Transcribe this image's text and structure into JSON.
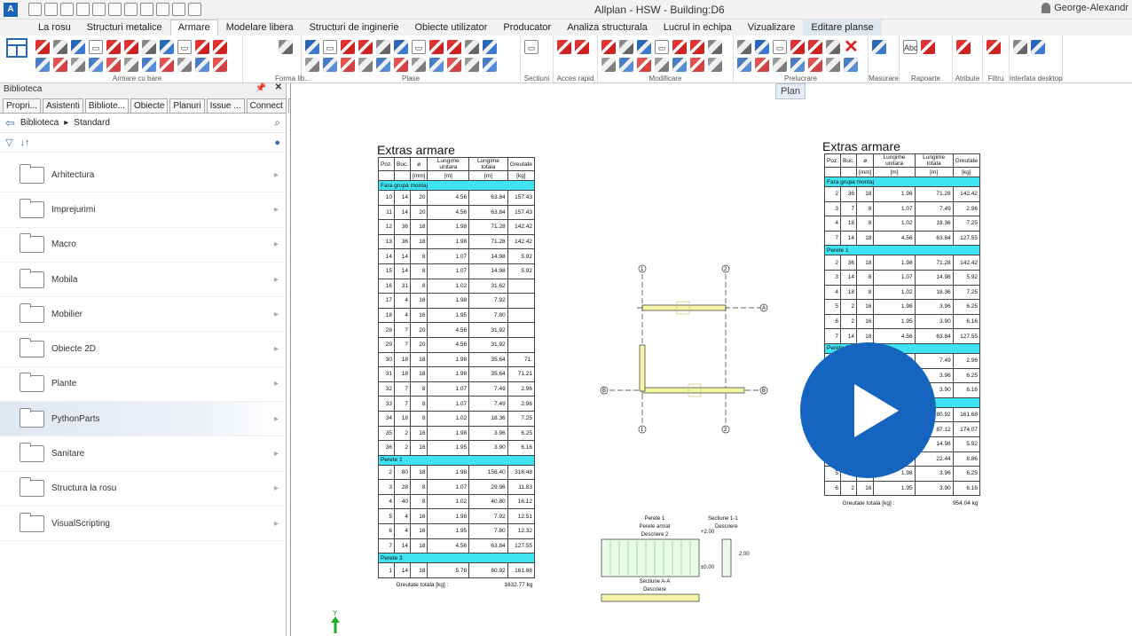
{
  "window": {
    "title": "Allplan - HSW - Building:D6",
    "user": "George-Alexandr"
  },
  "menu_tabs": [
    "La rosu",
    "Structuri metalice",
    "Armare",
    "Modelare libera",
    "Structuri de inginerie",
    "Obiecte utilizator",
    "Producator",
    "Analiza structurala",
    "Lucrul in echipa",
    "Vizualizare",
    "Editare planse"
  ],
  "ribbon_groups": [
    "Armare cu bare",
    "Forma lib...",
    "Plase",
    "Sectiuni",
    "Acces rapid",
    "Modificare",
    "Prelucrare",
    "Masurare",
    "Rapoarte",
    "Atribute",
    "Filtru",
    "Interfata desktop"
  ],
  "panel": {
    "title": "Biblioteca",
    "tabs": [
      "Propri...",
      "Asistenti",
      "Bibliote...",
      "Obiecte",
      "Planuri",
      "Issue ...",
      "Connect",
      "Layer"
    ],
    "breadcrumb": [
      "Biblioteca",
      "Standard"
    ],
    "folders": [
      "Arhitectura",
      "Imprejurimi",
      "Macro",
      "Mobila",
      "Mobilier",
      "Obiecte 2D",
      "Plante",
      "PythonParts",
      "Sanitare",
      "Structura la rosu",
      "VisualScripting"
    ],
    "selected": "PythonParts"
  },
  "view_label": "Plan",
  "left_table": {
    "title": "Extras armare",
    "headers": [
      "Poz.",
      "Buc.",
      "ø",
      "Lungime unitara",
      "Lungime totala",
      "Greutate"
    ],
    "units": [
      "",
      "",
      "[mm]",
      "[m]",
      "[m]",
      "[kg]"
    ],
    "groups": [
      {
        "name": "Fara grupa montaj",
        "rows": [
          [
            "10",
            "14",
            "20",
            "4.56",
            "63.84",
            "157.43"
          ],
          [
            "11",
            "14",
            "20",
            "4.56",
            "63.84",
            "157.43"
          ],
          [
            "12",
            "36",
            "18",
            "1.98",
            "71.28",
            "142.42"
          ],
          [
            "13",
            "36",
            "18",
            "1.98",
            "71.28",
            "142.42"
          ],
          [
            "14",
            "14",
            "8",
            "1.07",
            "14.98",
            "5.92"
          ],
          [
            "15",
            "14",
            "8",
            "1.07",
            "14.98",
            "5.92"
          ],
          [
            "16",
            "31",
            "8",
            "1.02",
            "31.62",
            ""
          ],
          [
            "17",
            "4",
            "16",
            "1.98",
            "7.92",
            ""
          ],
          [
            "18",
            "4",
            "16",
            "1.95",
            "7.80",
            ""
          ],
          [
            "28",
            "7",
            "20",
            "4.56",
            "31.92",
            ""
          ],
          [
            "29",
            "7",
            "20",
            "4.56",
            "31.92",
            ""
          ],
          [
            "30",
            "18",
            "18",
            "1.98",
            "35.64",
            "71."
          ],
          [
            "31",
            "18",
            "18",
            "1.98",
            "35.64",
            "71.21"
          ],
          [
            "32",
            "7",
            "8",
            "1.07",
            "7.49",
            "2.96"
          ],
          [
            "33",
            "7",
            "8",
            "1.07",
            "7.49",
            "2.96"
          ],
          [
            "34",
            "18",
            "8",
            "1.02",
            "18.36",
            "7.25"
          ],
          [
            "35",
            "2",
            "16",
            "1.98",
            "3.96",
            "6.25"
          ],
          [
            "36",
            "2",
            "16",
            "1.95",
            "3.90",
            "6.16"
          ]
        ]
      },
      {
        "name": "Perete 1",
        "rows": [
          [
            "2",
            "80",
            "18",
            "1.98",
            "158.40",
            "316.48"
          ],
          [
            "3",
            "28",
            "8",
            "1.07",
            "29.96",
            "11.83"
          ],
          [
            "4",
            "40",
            "8",
            "1.02",
            "40.80",
            "16.12"
          ],
          [
            "5",
            "4",
            "16",
            "1.98",
            "7.92",
            "12.51"
          ],
          [
            "6",
            "4",
            "16",
            "1.95",
            "7.80",
            "12.32"
          ],
          [
            "7",
            "14",
            "18",
            "4.56",
            "63.84",
            "127.55"
          ]
        ]
      },
      {
        "name": "Perete 3",
        "rows": [
          [
            "1",
            "14",
            "18",
            "5.78",
            "80.92",
            "161.68"
          ]
        ]
      }
    ],
    "total_label": "Greutate totala [kg] :",
    "total": "1632.77 kg"
  },
  "right_table": {
    "title": "Extras armare",
    "headers": [
      "Poz.",
      "Buc.",
      "ø",
      "Lungime unitara",
      "Lungime totala",
      "Greutate"
    ],
    "units": [
      "",
      "",
      "[mm]",
      "[m]",
      "[m]",
      "[kg]"
    ],
    "groups": [
      {
        "name": "Fara grupa montaj",
        "rows": [
          [
            "2",
            "36",
            "18",
            "1.98",
            "71.28",
            "142.42"
          ],
          [
            "3",
            "7",
            "8",
            "1.07",
            "7.49",
            "2.96"
          ],
          [
            "4",
            "18",
            "8",
            "1.02",
            "18.36",
            "7.25"
          ],
          [
            "7",
            "14",
            "18",
            "4.56",
            "63.84",
            "127.55"
          ]
        ]
      },
      {
        "name": "Perete 1",
        "rows": [
          [
            "2",
            "36",
            "18",
            "1.98",
            "71.28",
            "142.42"
          ],
          [
            "3",
            "14",
            "8",
            "1.07",
            "14.98",
            "5.92"
          ],
          [
            "4",
            "18",
            "8",
            "1.02",
            "18.36",
            "7.25"
          ],
          [
            "5",
            "2",
            "16",
            "1.98",
            "3.96",
            "6.25"
          ],
          [
            "6",
            "2",
            "16",
            "1.95",
            "3.90",
            "6.16"
          ],
          [
            "7",
            "14",
            "18",
            "4.56",
            "63.84",
            "127.55"
          ]
        ]
      },
      {
        "name": "Perete 2",
        "rows": [
          [
            "3",
            "7",
            "8",
            "1.07",
            "7.49",
            "2.96"
          ],
          [
            "5",
            "2",
            "16",
            "1.98",
            "3.96",
            "6.25"
          ],
          [
            "6",
            "2",
            "16",
            "1.95",
            "3.90",
            "6.16"
          ]
        ]
      },
      {
        "name": "Perete 3",
        "rows": [
          [
            "1",
            "14",
            "18",
            "5.78",
            "80.92",
            "161.68"
          ],
          [
            "2",
            "44",
            "18",
            "1.98",
            "87.12",
            "174.07"
          ],
          [
            "3",
            "14",
            "8",
            "1.07",
            "14.98",
            "5.92"
          ],
          [
            "4",
            "22",
            "8",
            "1.02",
            "22.44",
            "8.86"
          ],
          [
            "5",
            "2",
            "16",
            "1.98",
            "3.96",
            "6.25"
          ],
          [
            "6",
            "2",
            "16",
            "1.95",
            "3.90",
            "6.16"
          ]
        ]
      }
    ],
    "total_label": "Greutate totala [kg] :",
    "total": "954.04 kg"
  },
  "drawing": {
    "grid_labels": [
      "1",
      "2",
      "1",
      "2",
      "A",
      "B",
      "B"
    ],
    "wall_labels": [
      "Perete 1",
      "Perete armat",
      "Descriere 2",
      "Sectiune 1-1",
      "Descriere",
      "Sectiune A-A",
      "Descriere"
    ],
    "elev_top": "+2.00",
    "elev_bot": "±0.00",
    "dim": "2.00"
  },
  "colors": {
    "accent": "#1565c0",
    "group_row": "#3fe3f2"
  }
}
